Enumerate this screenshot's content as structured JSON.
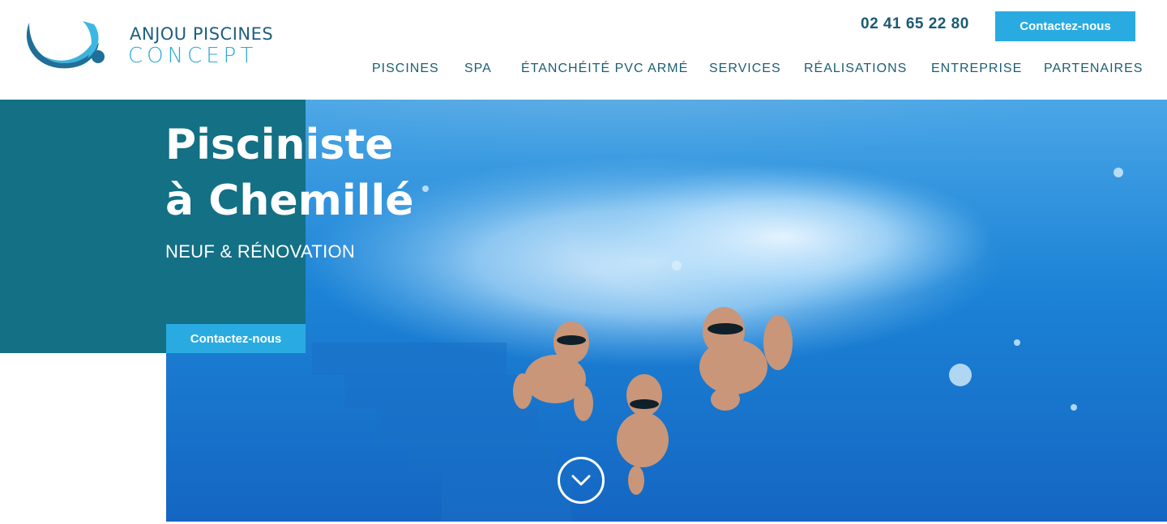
{
  "brand": {
    "line1": "ANJOU PISCINES",
    "line2": "CONCEPT",
    "logo_icon": "wave-logo-icon",
    "colors": {
      "dark": "#1e5f80",
      "light": "#2aa9d6"
    }
  },
  "header": {
    "phone": "02 41 65 22 80",
    "cta_label": "Contactez-nous"
  },
  "nav": {
    "items": [
      {
        "label": "PISCINES"
      },
      {
        "label": "SPA"
      },
      {
        "label": "ÉTANCHÉITÉ PVC ARMÉ"
      },
      {
        "label": "SERVICES"
      },
      {
        "label": "RÉALISATIONS"
      },
      {
        "label": "ENTREPRISE"
      },
      {
        "label": "PARTENAIRES"
      }
    ]
  },
  "hero": {
    "title_line1": "Pisciniste",
    "title_line2": "à Chemillé",
    "subtitle": "NEUF & RÉNOVATION",
    "cta_label": "Contactez-nous",
    "scroll_icon": "chevron-down-icon",
    "colors": {
      "panel": "#137085",
      "accent": "#29abe2",
      "water": "#1a7fd1"
    }
  }
}
